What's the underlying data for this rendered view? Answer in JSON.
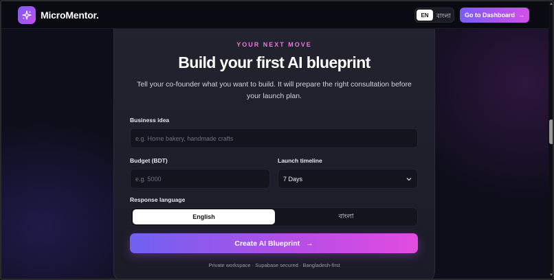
{
  "header": {
    "brand": "MicroMentor.",
    "lang_en": "EN",
    "lang_bn": "বাংলা",
    "dashboard_label": "Go to Dashboard",
    "dashboard_arrow": "→"
  },
  "hero": {
    "eyebrow": "YOUR NEXT MOVE",
    "title": "Build your first AI blueprint",
    "subtitle": "Tell your co-founder what you want to build. It will prepare the right consultation before your launch plan."
  },
  "form": {
    "business_idea": {
      "label": "Business idea",
      "placeholder": "e.g. Home bakery, handmade crafts"
    },
    "budget": {
      "label": "Budget (BDT)",
      "placeholder": "e.g. 5000"
    },
    "timeline": {
      "label": "Launch timeline",
      "value": "7 Days"
    },
    "response_language": {
      "label": "Response language",
      "options": [
        "English",
        "বাংলা"
      ],
      "selected": "English"
    },
    "submit_label": "Create AI Blueprint",
    "submit_arrow": "→"
  },
  "footer_note": "Private workspace · Supabase secured · Bangladesh-first",
  "colors": {
    "accent_start": "#7b5cf6",
    "accent_end": "#d24fe8",
    "eyebrow": "#e879d9",
    "background": "#0e0e1b"
  },
  "icons": {
    "logo": "sparkle-icon",
    "dashboard_arrow": "arrow-right-icon",
    "timeline_chevron": "chevron-down-icon",
    "submit_arrow": "arrow-right-icon"
  }
}
